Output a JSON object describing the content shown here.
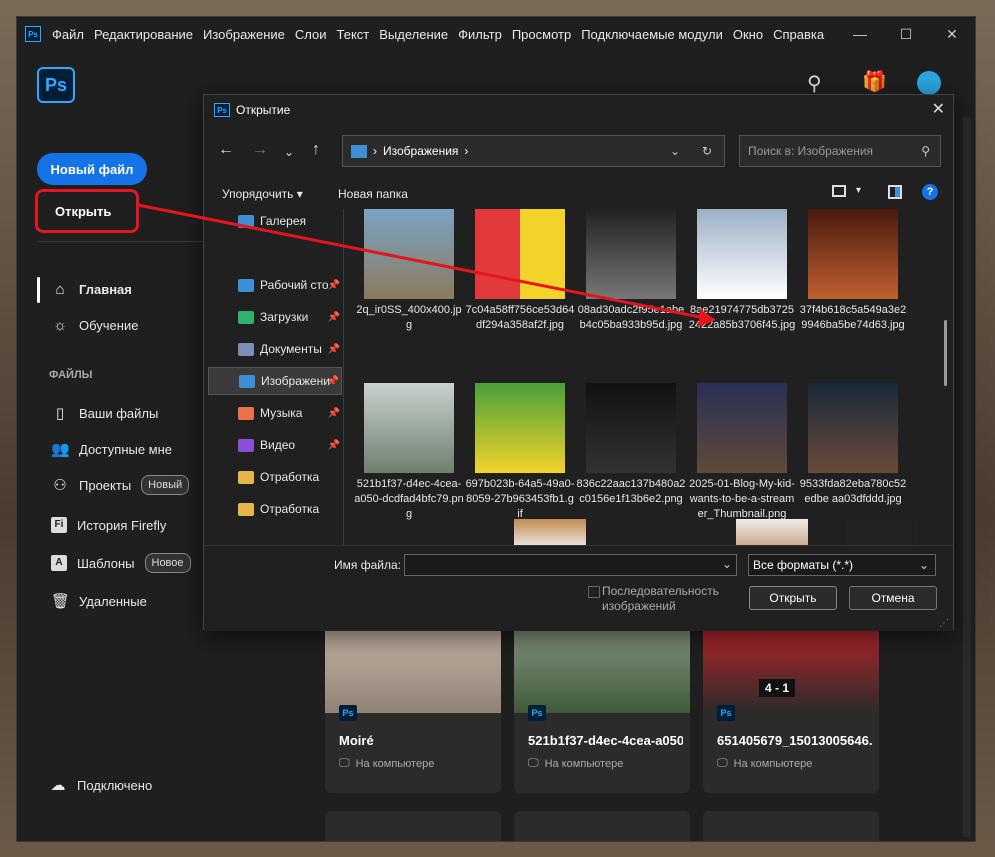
{
  "menu": [
    "Файл",
    "Редактирование",
    "Изображение",
    "Слои",
    "Текст",
    "Выделение",
    "Фильтр",
    "Просмотр",
    "Подключаемые модули",
    "Окно",
    "Справка"
  ],
  "app_logo": "Ps",
  "home": {
    "new_file": "Новый файл",
    "open": "Открыть",
    "nav_home": "Главная",
    "nav_learn": "Обучение",
    "section_files": "ФАЙЛЫ",
    "your_files": "Ваши файлы",
    "shared": "Доступные мне",
    "projects": "Проекты",
    "projects_badge": "Новый",
    "firefly": "История Firefly",
    "templates": "Шаблоны",
    "templates_badge": "Новое",
    "deleted": "Удаленные",
    "connected": "Подключено"
  },
  "cards": [
    {
      "name": "Moiré",
      "location": "На компьютере"
    },
    {
      "name": "521b1f37-d4ec-4cea-a050...",
      "location": "На компьютере"
    },
    {
      "name": "651405679_15013005646...",
      "location": "На компьютере"
    }
  ],
  "scoreboard": "4 - 1",
  "dialog": {
    "title": "Открытие",
    "path": "Изображения",
    "search_placeholder": "Поиск в: Изображения",
    "organize": "Упорядочить",
    "new_folder": "Новая папка",
    "tree": [
      {
        "label": "Галерея",
        "pinned": false
      },
      {
        "label": "Рабочий сто",
        "pinned": true
      },
      {
        "label": "Загрузки",
        "pinned": true
      },
      {
        "label": "Документы",
        "pinned": true
      },
      {
        "label": "Изображени",
        "pinned": true
      },
      {
        "label": "Музыка",
        "pinned": true
      },
      {
        "label": "Видео",
        "pinned": true
      },
      {
        "label": "Отработка",
        "pinned": false
      },
      {
        "label": "Отработка",
        "pinned": false
      }
    ],
    "files": [
      {
        "name": "2q_ir0SS_400x400.jpg"
      },
      {
        "name": "7c04a58ff756ce53d64df294a358af2f.jpg"
      },
      {
        "name": "08ad30adc2f95e1abeb4c05ba933b95d.jpg"
      },
      {
        "name": "8ae21974775db37252422a85b3706f45.jpg"
      },
      {
        "name": "37f4b618c5a549a3e29946ba5be74d63.jpg"
      },
      {
        "name": "521b1f37-d4ec-4cea-a050-dcdfad4bfc79.png"
      },
      {
        "name": "697b023b-64a5-49a0-8059-27b963453fb1.gif"
      },
      {
        "name": "836c22aac137b480a2c0156e1f13b6e2.png"
      },
      {
        "name": "2025-01-Blog-My-kid-wants-to-be-a-streamer_Thumbnail.png"
      },
      {
        "name": "9533fda82eba780c52edbe aa03dfddd.jpg"
      }
    ],
    "filename_label": "Имя файла:",
    "filename_value": "",
    "filetype": "Все форматы (*.*)",
    "sequence_label": "Последовательность изображений",
    "open_button": "Открыть",
    "cancel_button": "Отмена"
  },
  "colors": {
    "accent": "#1473e6",
    "ps_blue": "#31a8ff",
    "highlight": "#e5141d"
  }
}
